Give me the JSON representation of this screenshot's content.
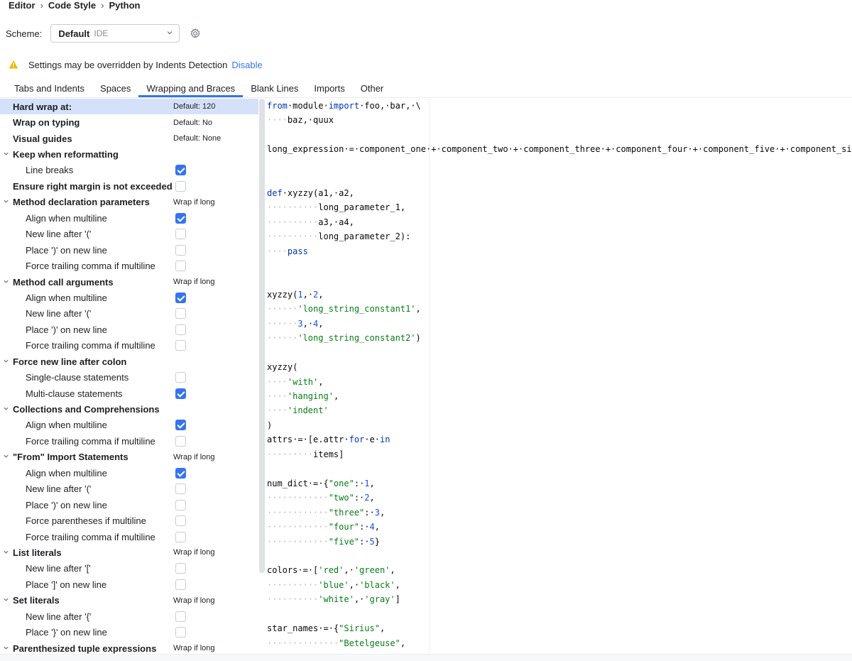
{
  "breadcrumb": [
    "Editor",
    "Code Style",
    "Python"
  ],
  "scheme": {
    "label": "Scheme:",
    "name": "Default",
    "kind": "IDE"
  },
  "warning": {
    "text": "Settings may be overridden by Indents Detection",
    "link": "Disable"
  },
  "tabs": [
    "Tabs and Indents",
    "Spaces",
    "Wrapping and Braces",
    "Blank Lines",
    "Imports",
    "Other"
  ],
  "active_tab": "Wrapping and Braces",
  "options": [
    {
      "label": "Hard wrap at:",
      "level": 0,
      "value": "Default: 120",
      "selected": true
    },
    {
      "label": "Wrap on typing",
      "level": 0,
      "value": "Default: No"
    },
    {
      "label": "Visual guides",
      "level": 0,
      "value": "Default: None"
    },
    {
      "label": "Keep when reformatting",
      "level": 0,
      "group": true
    },
    {
      "label": "Line breaks",
      "level": 1,
      "checked": true
    },
    {
      "label": "Ensure right margin is not exceeded",
      "level": 0,
      "checked": false
    },
    {
      "label": "Method declaration parameters",
      "level": 0,
      "group": true,
      "value": "Wrap if long"
    },
    {
      "label": "Align when multiline",
      "level": 1,
      "checked": true
    },
    {
      "label": "New line after '('",
      "level": 1,
      "checked": false
    },
    {
      "label": "Place ')' on new line",
      "level": 1,
      "checked": false
    },
    {
      "label": "Force trailing comma if multiline",
      "level": 1,
      "checked": false
    },
    {
      "label": "Method call arguments",
      "level": 0,
      "group": true,
      "value": "Wrap if long"
    },
    {
      "label": "Align when multiline",
      "level": 1,
      "checked": true
    },
    {
      "label": "New line after '('",
      "level": 1,
      "checked": false
    },
    {
      "label": "Place ')' on new line",
      "level": 1,
      "checked": false
    },
    {
      "label": "Force trailing comma if multiline",
      "level": 1,
      "checked": false
    },
    {
      "label": "Force new line after colon",
      "level": 0,
      "group": true
    },
    {
      "label": "Single-clause statements",
      "level": 1,
      "checked": false
    },
    {
      "label": "Multi-clause statements",
      "level": 1,
      "checked": true
    },
    {
      "label": "Collections and Comprehensions",
      "level": 0,
      "group": true
    },
    {
      "label": "Align when multiline",
      "level": 1,
      "checked": true
    },
    {
      "label": "Force trailing comma if multiline",
      "level": 1,
      "checked": false
    },
    {
      "label": "\"From\" Import Statements",
      "level": 0,
      "group": true,
      "value": "Wrap if long"
    },
    {
      "label": "Align when multiline",
      "level": 1,
      "checked": true
    },
    {
      "label": "New line after '('",
      "level": 1,
      "checked": false
    },
    {
      "label": "Place ')' on new line",
      "level": 1,
      "checked": false
    },
    {
      "label": "Force parentheses if multiline",
      "level": 1,
      "checked": false
    },
    {
      "label": "Force trailing comma if multiline",
      "level": 1,
      "checked": false
    },
    {
      "label": "List literals",
      "level": 0,
      "group": true,
      "value": "Wrap if long"
    },
    {
      "label": "New line after '['",
      "level": 1,
      "checked": false
    },
    {
      "label": "Place ']' on new line",
      "level": 1,
      "checked": false
    },
    {
      "label": "Set literals",
      "level": 0,
      "group": true,
      "value": "Wrap if long"
    },
    {
      "label": "New line after '{'",
      "level": 1,
      "checked": false
    },
    {
      "label": "Place '}' on new line",
      "level": 1,
      "checked": false
    },
    {
      "label": "Parenthesized tuple expressions",
      "level": 0,
      "group": true,
      "value": "Wrap if long"
    }
  ],
  "code_lines": [
    {
      "row": 0,
      "tokens": [
        [
          "kw",
          "from"
        ],
        [
          "",
          "·module·"
        ],
        [
          "kw",
          "import"
        ],
        [
          "",
          "·foo,·bar,·\\"
        ]
      ]
    },
    {
      "row": 1,
      "tokens": [
        [
          "dot",
          "····"
        ],
        [
          "",
          "baz,·quux"
        ]
      ]
    },
    {
      "row": 3,
      "tokens": [
        [
          "",
          "long_expression·=·component_one·+·component_two·+·component_three·+·component_four·+·component_five·+·component_six"
        ]
      ]
    },
    {
      "row": 6,
      "tokens": [
        [
          "kw",
          "def"
        ],
        [
          "",
          "·xyzzy(a1,·a2,"
        ]
      ]
    },
    {
      "row": 7,
      "tokens": [
        [
          "dot",
          "··········"
        ],
        [
          "",
          "long_parameter_1,"
        ]
      ]
    },
    {
      "row": 8,
      "tokens": [
        [
          "dot",
          "··········"
        ],
        [
          "",
          "a3,·a4,"
        ]
      ]
    },
    {
      "row": 9,
      "tokens": [
        [
          "dot",
          "··········"
        ],
        [
          "",
          "long_parameter_2):"
        ]
      ]
    },
    {
      "row": 10,
      "tokens": [
        [
          "dot",
          "····"
        ],
        [
          "kw",
          "pass"
        ]
      ]
    },
    {
      "row": 13,
      "tokens": [
        [
          "",
          "xyzzy("
        ],
        [
          "num",
          "1"
        ],
        [
          "",
          ",·"
        ],
        [
          "num",
          "2"
        ],
        [
          "",
          ","
        ]
      ]
    },
    {
      "row": 14,
      "tokens": [
        [
          "dot",
          "······"
        ],
        [
          "str",
          "'long_string_constant1'"
        ],
        [
          "",
          ","
        ]
      ]
    },
    {
      "row": 15,
      "tokens": [
        [
          "dot",
          "······"
        ],
        [
          "num",
          "3"
        ],
        [
          "",
          ",·"
        ],
        [
          "num",
          "4"
        ],
        [
          "",
          ","
        ]
      ]
    },
    {
      "row": 16,
      "tokens": [
        [
          "dot",
          "······"
        ],
        [
          "str",
          "'long_string_constant2'"
        ],
        [
          "",
          ")"
        ]
      ]
    },
    {
      "row": 18,
      "tokens": [
        [
          "",
          "xyzzy("
        ]
      ]
    },
    {
      "row": 19,
      "tokens": [
        [
          "dot",
          "····"
        ],
        [
          "str",
          "'with'"
        ],
        [
          "",
          ","
        ]
      ]
    },
    {
      "row": 20,
      "tokens": [
        [
          "dot",
          "····"
        ],
        [
          "str",
          "'hanging'"
        ],
        [
          "",
          ","
        ]
      ]
    },
    {
      "row": 21,
      "tokens": [
        [
          "dot",
          "····"
        ],
        [
          "str",
          "'indent'"
        ]
      ]
    },
    {
      "row": 22,
      "tokens": [
        [
          "",
          ")"
        ]
      ]
    },
    {
      "row": 23,
      "tokens": [
        [
          "",
          "attrs·=·[e.attr·"
        ],
        [
          "kw",
          "for"
        ],
        [
          "",
          "·e·"
        ],
        [
          "kw",
          "in"
        ]
      ]
    },
    {
      "row": 24,
      "tokens": [
        [
          "dot",
          "·········"
        ],
        [
          "",
          "items]"
        ]
      ]
    },
    {
      "row": 26,
      "tokens": [
        [
          "",
          "num_dict·=·{"
        ],
        [
          "str",
          "\"one\""
        ],
        [
          "",
          ":·"
        ],
        [
          "num",
          "1"
        ],
        [
          "",
          ","
        ]
      ]
    },
    {
      "row": 27,
      "tokens": [
        [
          "dot",
          "············"
        ],
        [
          "str",
          "\"two\""
        ],
        [
          "",
          ":·"
        ],
        [
          "num",
          "2"
        ],
        [
          "",
          ","
        ]
      ]
    },
    {
      "row": 28,
      "tokens": [
        [
          "dot",
          "············"
        ],
        [
          "str",
          "\"three\""
        ],
        [
          "",
          ":·"
        ],
        [
          "num",
          "3"
        ],
        [
          "",
          ","
        ]
      ]
    },
    {
      "row": 29,
      "tokens": [
        [
          "dot",
          "············"
        ],
        [
          "str",
          "\"four\""
        ],
        [
          "",
          ":·"
        ],
        [
          "num",
          "4"
        ],
        [
          "",
          ","
        ]
      ]
    },
    {
      "row": 30,
      "tokens": [
        [
          "dot",
          "············"
        ],
        [
          "str",
          "\"five\""
        ],
        [
          "",
          ":·"
        ],
        [
          "num",
          "5"
        ],
        [
          "",
          "}"
        ]
      ]
    },
    {
      "row": 32,
      "tokens": [
        [
          "",
          "colors·=·["
        ],
        [
          "str",
          "'red'"
        ],
        [
          "",
          ",·"
        ],
        [
          "str",
          "'green'"
        ],
        [
          "",
          ","
        ]
      ]
    },
    {
      "row": 33,
      "tokens": [
        [
          "dot",
          "··········"
        ],
        [
          "str",
          "'blue'"
        ],
        [
          "",
          ",·"
        ],
        [
          "str",
          "'black'"
        ],
        [
          "",
          ","
        ]
      ]
    },
    {
      "row": 34,
      "tokens": [
        [
          "dot",
          "··········"
        ],
        [
          "str",
          "'white'"
        ],
        [
          "",
          ",·"
        ],
        [
          "str",
          "'gray'"
        ],
        [
          "",
          "]"
        ]
      ]
    },
    {
      "row": 36,
      "tokens": [
        [
          "",
          "star_names·=·{"
        ],
        [
          "str",
          "\"Sirius\""
        ],
        [
          "",
          ","
        ]
      ]
    },
    {
      "row": 37,
      "tokens": [
        [
          "dot",
          "··············"
        ],
        [
          "str",
          "\"Betelgeuse\""
        ],
        [
          "",
          ","
        ]
      ]
    }
  ],
  "colors": {
    "accent": "#3574f0",
    "selection": "#d5e1f9",
    "keyword": "#0033b3",
    "string": "#067d17",
    "number": "#1750eb",
    "warning": "#f2b300"
  }
}
